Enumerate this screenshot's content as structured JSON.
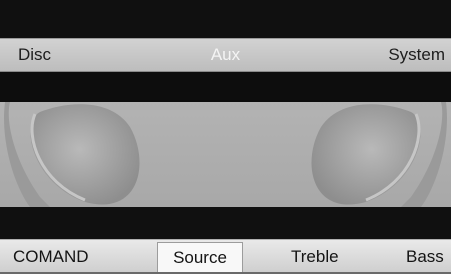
{
  "menu": {
    "items": [
      {
        "label": "Disc"
      },
      {
        "label": "Aux"
      },
      {
        "label": "System"
      }
    ]
  },
  "main": {
    "panel_icon": "headphones-icon"
  },
  "softkeys": {
    "items": [
      {
        "label": "COMAND"
      },
      {
        "label": "Source"
      },
      {
        "label": "Treble"
      },
      {
        "label": "Bass"
      }
    ],
    "selected": "Source"
  },
  "colors": {
    "menu_bar": "#c8c8c8",
    "panel": "#adadad",
    "active_menu_text": "#f4f4f4",
    "softkey_bar": "#dedede"
  }
}
